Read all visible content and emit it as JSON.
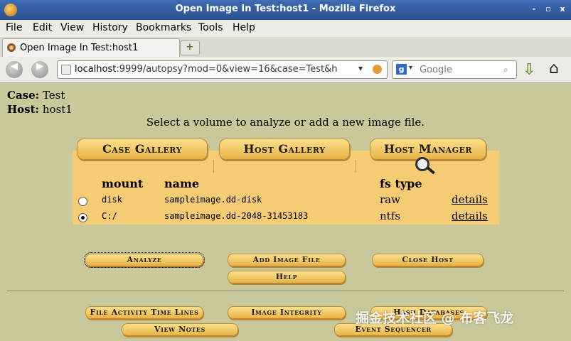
{
  "window": {
    "title": "Open Image In Test:host1 - Mozilla Firefox",
    "controls": [
      "-",
      "▫",
      "x"
    ]
  },
  "menu": [
    "File",
    "Edit",
    "View",
    "History",
    "Bookmarks",
    "Tools",
    "Help"
  ],
  "tab": {
    "label": "Open Image In Test:host1",
    "new_tab": "+"
  },
  "nav": {
    "url_host": "localhost",
    "url_rest": ":9999/autopsy?mod=0&view=16&case=Test&h",
    "search_placeholder": "Google"
  },
  "page": {
    "case_label": "Case:",
    "case_value": "Test",
    "host_label": "Host:",
    "host_value": "host1",
    "instruction": "Select a volume to analyze or add a new image file.",
    "top_tabs": [
      "Case Gallery",
      "Host Gallery",
      "Host Manager"
    ],
    "columns": {
      "mount": "mount",
      "name": "name",
      "fs_type": "fs type"
    },
    "rows": [
      {
        "mount": "disk",
        "name": "sampleimage.dd-disk",
        "fs_type": "raw",
        "details": "details",
        "selected": false
      },
      {
        "mount": "C:/",
        "name": "sampleimage.dd-2048-31453183",
        "fs_type": "ntfs",
        "details": "details",
        "selected": true
      }
    ],
    "buttons": {
      "analyze": "Analyze",
      "add_image_file": "Add Image File",
      "close_host": "Close Host",
      "help": "Help",
      "file_activity": "File Activity Time Lines",
      "image_integrity": "Image Integrity",
      "hash_databases": "Hash Databases",
      "view_notes": "View Notes",
      "event_sequencer": "Event Sequencer"
    },
    "watermark": "掘金技术社区 @ 布客飞龙"
  }
}
